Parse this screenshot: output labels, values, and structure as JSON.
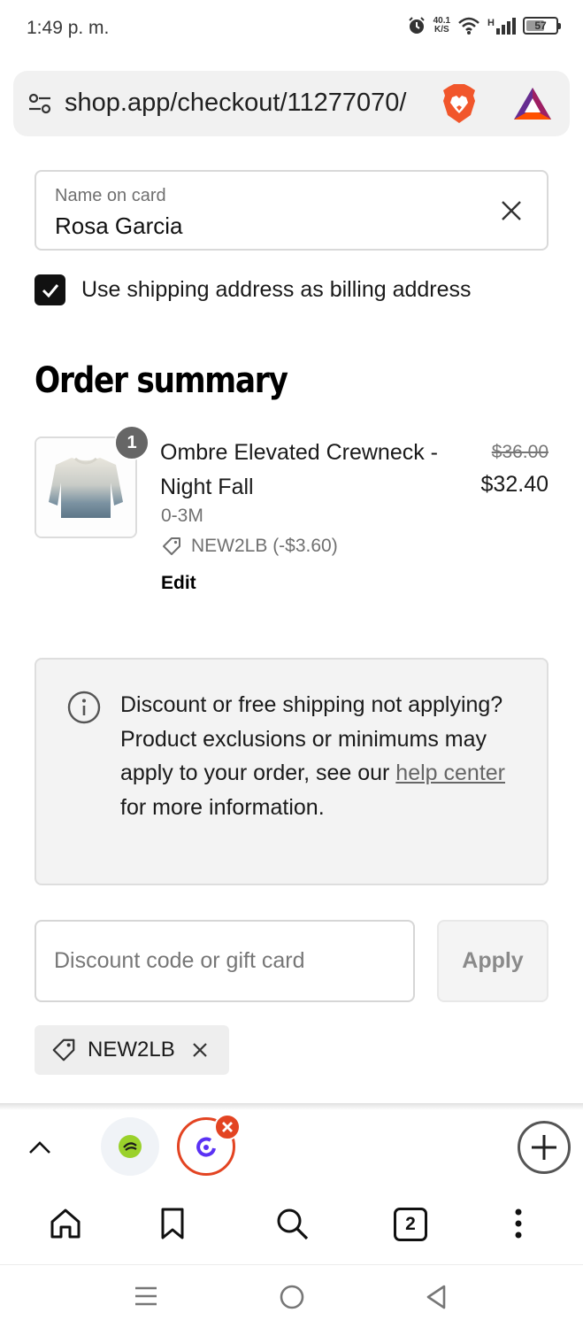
{
  "status_bar": {
    "time": "1:49 p. m.",
    "net_speed_value": "40.1",
    "net_speed_unit": "K/S",
    "network_type": "H",
    "battery_level": "57"
  },
  "browser": {
    "url": "shop.app/checkout/11277070/",
    "open_tabs_count": "2"
  },
  "payment": {
    "name_label": "Name on card",
    "name_value": "Rosa Garcia",
    "billing_checkbox_label": "Use shipping address as billing address",
    "billing_checked": true
  },
  "order_summary": {
    "title": "Order summary",
    "item": {
      "quantity": "1",
      "name": "Ombre Elevated Crewneck - Night Fall",
      "variant": "0-3M",
      "original_price": "$36.00",
      "price": "$32.40",
      "discount": "NEW2LB (-$3.60)",
      "edit_label": "Edit"
    }
  },
  "notice": {
    "text_before": "Discount or free shipping not applying? Product exclusions or minimums may apply to your order, see our ",
    "link_text": "help center",
    "text_after": " for more information."
  },
  "discount": {
    "placeholder": "Discount code or gift card",
    "apply_label": "Apply",
    "applied_code": "NEW2LB"
  },
  "colors": {
    "accent_dark": "#111111",
    "brave_orange": "#e34422",
    "muted_text": "#707070"
  },
  "icons": {
    "url_settings": "tune-icon",
    "brave": "brave-lion-icon",
    "bat": "bat-triangle-icon",
    "clear": "close-icon",
    "tag": "tag-icon",
    "info": "info-icon"
  }
}
